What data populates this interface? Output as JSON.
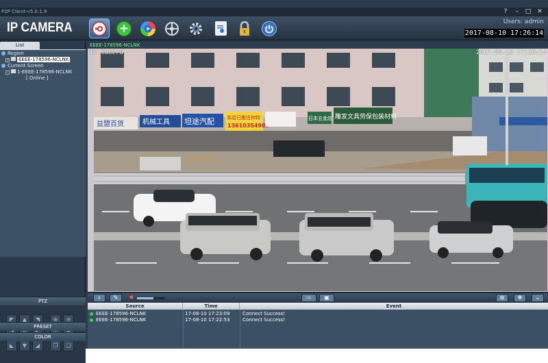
{
  "window": {
    "title": "P2P Client-v5.0.1.9",
    "help": "?",
    "minimize": "–",
    "maximize": "□",
    "close": "✕"
  },
  "header": {
    "logo": "IP CAMERA",
    "users": "Users: admin",
    "datetime": "2017-08-10  17:26:14",
    "toolbar": [
      {
        "name": "live-view",
        "icon": "camera-icon"
      },
      {
        "name": "add-device",
        "icon": "plus-icon"
      },
      {
        "name": "playback",
        "icon": "play-icon"
      },
      {
        "name": "remote-config",
        "icon": "crosshair-icon"
      },
      {
        "name": "settings",
        "icon": "gear-icon"
      },
      {
        "name": "log",
        "icon": "document-icon"
      },
      {
        "name": "lock",
        "icon": "lock-icon"
      },
      {
        "name": "power",
        "icon": "power-icon"
      }
    ]
  },
  "sidebar": {
    "tab": "List",
    "tree": {
      "region": "Region",
      "device": "EEEE-178596-NCLNK",
      "current_screen": "Current Screen",
      "screen_device": "1-EEEE-178596-NCLNK",
      "screen_status": "[    Online    ]"
    },
    "ptz_title": "PTZ",
    "preset": "PRESET",
    "color": "COLOR"
  },
  "video": {
    "channel_label": "EEEE-178596-NCLNK",
    "osd_name": "IP Camera",
    "osd_time": "2017-08-10 17:26:14",
    "volume": 0.6,
    "signs": {
      "shop1": "益盟百货",
      "shop2": "机械工具",
      "shop3": "坦途汽配",
      "shop4": "本店已搬往何特",
      "phone": "13610354983",
      "shop5": "日本五金店",
      "shop6": "雕发文具劳保包装材料"
    }
  },
  "log": {
    "headers": [
      "Source",
      "Time",
      "Event"
    ],
    "rows": [
      {
        "source": "EEEE-178596-NCLNK",
        "time": "17-08-10 17:23:09",
        "event": "Connect Success!"
      },
      {
        "source": "EEEE-178596-NCLNK",
        "time": "17-08-10 17:22:53",
        "event": "Connect Success!"
      }
    ]
  },
  "colors": {
    "accent": "#6aa0d0",
    "panel": "#2c3c4e",
    "online": "#2ee04a",
    "channel_label": "#73ff7a"
  }
}
